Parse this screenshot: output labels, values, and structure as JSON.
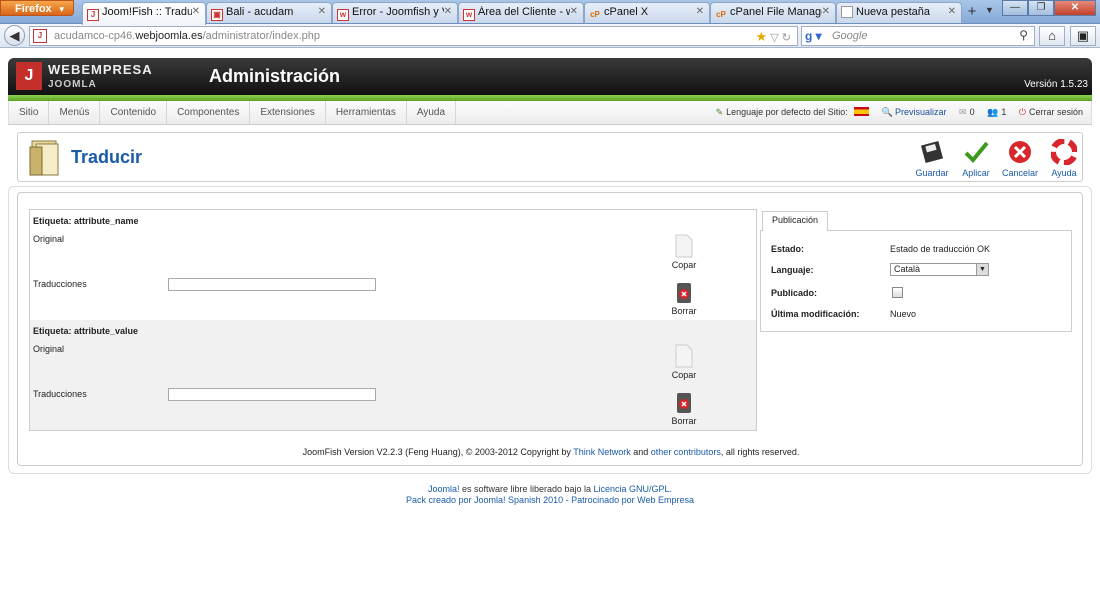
{
  "browser": {
    "app_button": "Firefox",
    "tabs": [
      {
        "title": "Joom!Fish :: Traducir",
        "icon": "joomla-icon",
        "active": true
      },
      {
        "title": "Bali - acudam",
        "icon": "web-icon"
      },
      {
        "title": "Error - Joomfish y V...",
        "icon": "webempresa-icon"
      },
      {
        "title": "Área del Cliente - w...",
        "icon": "webempresa-icon"
      },
      {
        "title": "cPanel X",
        "icon": "cpanel-icon"
      },
      {
        "title": "cPanel File Manage...",
        "icon": "cpanel-icon"
      },
      {
        "title": "Nueva pestaña",
        "icon": "blank-page-icon"
      }
    ],
    "url_prefix": "acudamco-cp46.",
    "url_domain": "webjoomla.es",
    "url_path": "/administrator/index.php",
    "search_placeholder": "Google"
  },
  "header": {
    "brand": "WEBEMPRESA",
    "brand_sub": "JOOMLA",
    "title": "Administración",
    "version": "Versión 1.5.23"
  },
  "menu": [
    "Sitio",
    "Menús",
    "Contenido",
    "Componentes",
    "Extensiones",
    "Herramientas",
    "Ayuda"
  ],
  "status": {
    "default_lang": "Lenguaje por defecto del Sitio:",
    "preview": "Previsualizar",
    "messages": "0",
    "users": "1",
    "logout": "Cerrar sesión"
  },
  "toolbar": {
    "page_title": "Traducir",
    "save": "Guardar",
    "apply": "Aplicar",
    "cancel": "Cancelar",
    "help": "Ayuda"
  },
  "fields": [
    {
      "label": "Etiqueta: attribute_name",
      "original": "Original",
      "translations": "Traducciones",
      "copy": "Copar",
      "delete": "Borrar"
    },
    {
      "label": "Etiqueta: attribute_value",
      "original": "Original",
      "translations": "Traducciones",
      "copy": "Copar",
      "delete": "Borrar"
    }
  ],
  "publication": {
    "tab": "Publicación",
    "state_label": "Estado:",
    "state_value": "Estado de traducción OK",
    "language_label": "Languaje:",
    "language_value": "Català",
    "published_label": "Publicado:",
    "modified_label": "Última modificación:",
    "modified_value": "Nuevo"
  },
  "copyright": {
    "before": "JoomFish Version V2.2.3 (Feng Huang), © 2003-2012 Copyright by ",
    "link1": "Think Network",
    "mid": " and ",
    "link2": "other contributors",
    "after": ", all rights reserved."
  },
  "footer": {
    "joomla": "Joomla!",
    "text1": " es software libre liberado bajo la ",
    "license": "Licencia GNU/GPL.",
    "line2": "Pack creado por Joomla! Spanish 2010 - Patrocinado por Web Empresa"
  }
}
